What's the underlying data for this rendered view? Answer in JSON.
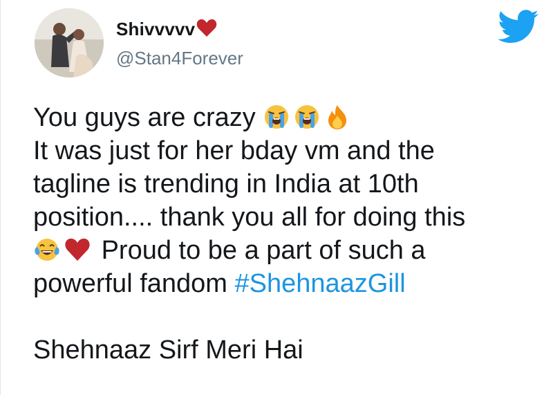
{
  "user": {
    "display_name": "Shivvvvv",
    "handle": "@Stan4Forever"
  },
  "icons": {
    "name_badge": "heart-icon",
    "platform": "twitter-bird-icon",
    "emojis": [
      "loudly-crying-face-icon",
      "loudly-crying-face-icon",
      "fire-icon",
      "face-with-tears-of-joy-icon",
      "heart-icon"
    ]
  },
  "colors": {
    "heart": "#c1272d",
    "hashtag": "#1b95e0",
    "twitter_blue": "#1da1f2",
    "handle": "#657786"
  },
  "tweet": {
    "line1": "You guys are crazy",
    "line2": "It was just for her bday vm and the",
    "line3": "tagline is trending in India at 10th",
    "line4": "position.... thank you all for doing this",
    "line5": "Proud to be a part of such a",
    "line6_text": "powerful fandom ",
    "hashtag": "#ShehnaazGill",
    "line8": "Shehnaaz Sirf Meri Hai"
  }
}
